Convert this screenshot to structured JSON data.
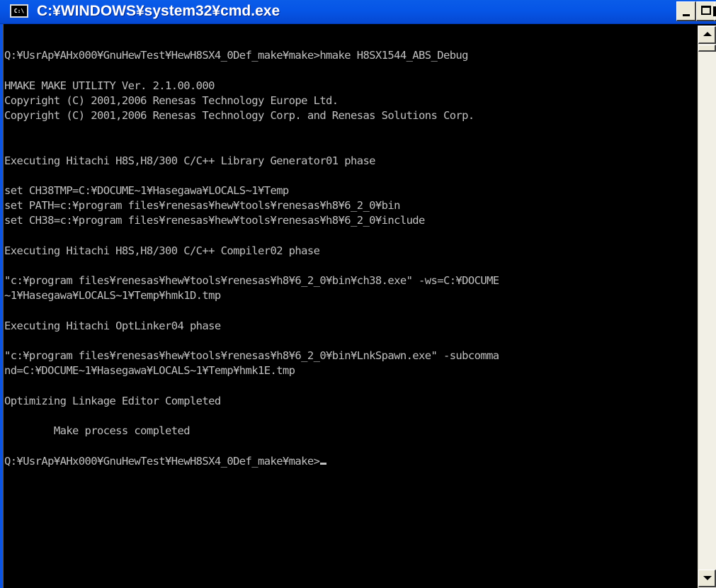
{
  "window": {
    "title": "C:¥WINDOWS¥system32¥cmd.exe",
    "icon_text": "C:\\"
  },
  "colors": {
    "titlebar": "#0655e6",
    "console_bg": "#000000",
    "console_fg": "#c0c0c0"
  },
  "console": {
    "lines": [
      "",
      "Q:¥UsrAp¥AHx000¥GnuHewTest¥HewH8SX4_0Def_make¥make>hmake H8SX1544_ABS_Debug",
      "",
      "HMAKE MAKE UTILITY Ver. 2.1.00.000",
      "Copyright (C) 2001,2006 Renesas Technology Europe Ltd.",
      "Copyright (C) 2001,2006 Renesas Technology Corp. and Renesas Solutions Corp.",
      "",
      "",
      "Executing Hitachi H8S,H8/300 C/C++ Library Generator01 phase",
      "",
      "set CH38TMP=C:¥DOCUME~1¥Hasegawa¥LOCALS~1¥Temp",
      "set PATH=c:¥program files¥renesas¥hew¥tools¥renesas¥h8¥6_2_0¥bin",
      "set CH38=c:¥program files¥renesas¥hew¥tools¥renesas¥h8¥6_2_0¥include",
      "",
      "Executing Hitachi H8S,H8/300 C/C++ Compiler02 phase",
      "",
      "\"c:¥program files¥renesas¥hew¥tools¥renesas¥h8¥6_2_0¥bin¥ch38.exe\" -ws=C:¥DOCUME",
      "~1¥Hasegawa¥LOCALS~1¥Temp¥hmk1D.tmp",
      "",
      "Executing Hitachi OptLinker04 phase",
      "",
      "\"c:¥program files¥renesas¥hew¥tools¥renesas¥h8¥6_2_0¥bin¥LnkSpawn.exe\" -subcomma",
      "nd=C:¥DOCUME~1¥Hasegawa¥LOCALS~1¥Temp¥hmk1E.tmp",
      "",
      "Optimizing Linkage Editor Completed",
      "",
      "        Make process completed",
      ""
    ],
    "prompt": "Q:¥UsrAp¥AHx000¥GnuHewTest¥HewH8SX4_0Def_make¥make>"
  }
}
